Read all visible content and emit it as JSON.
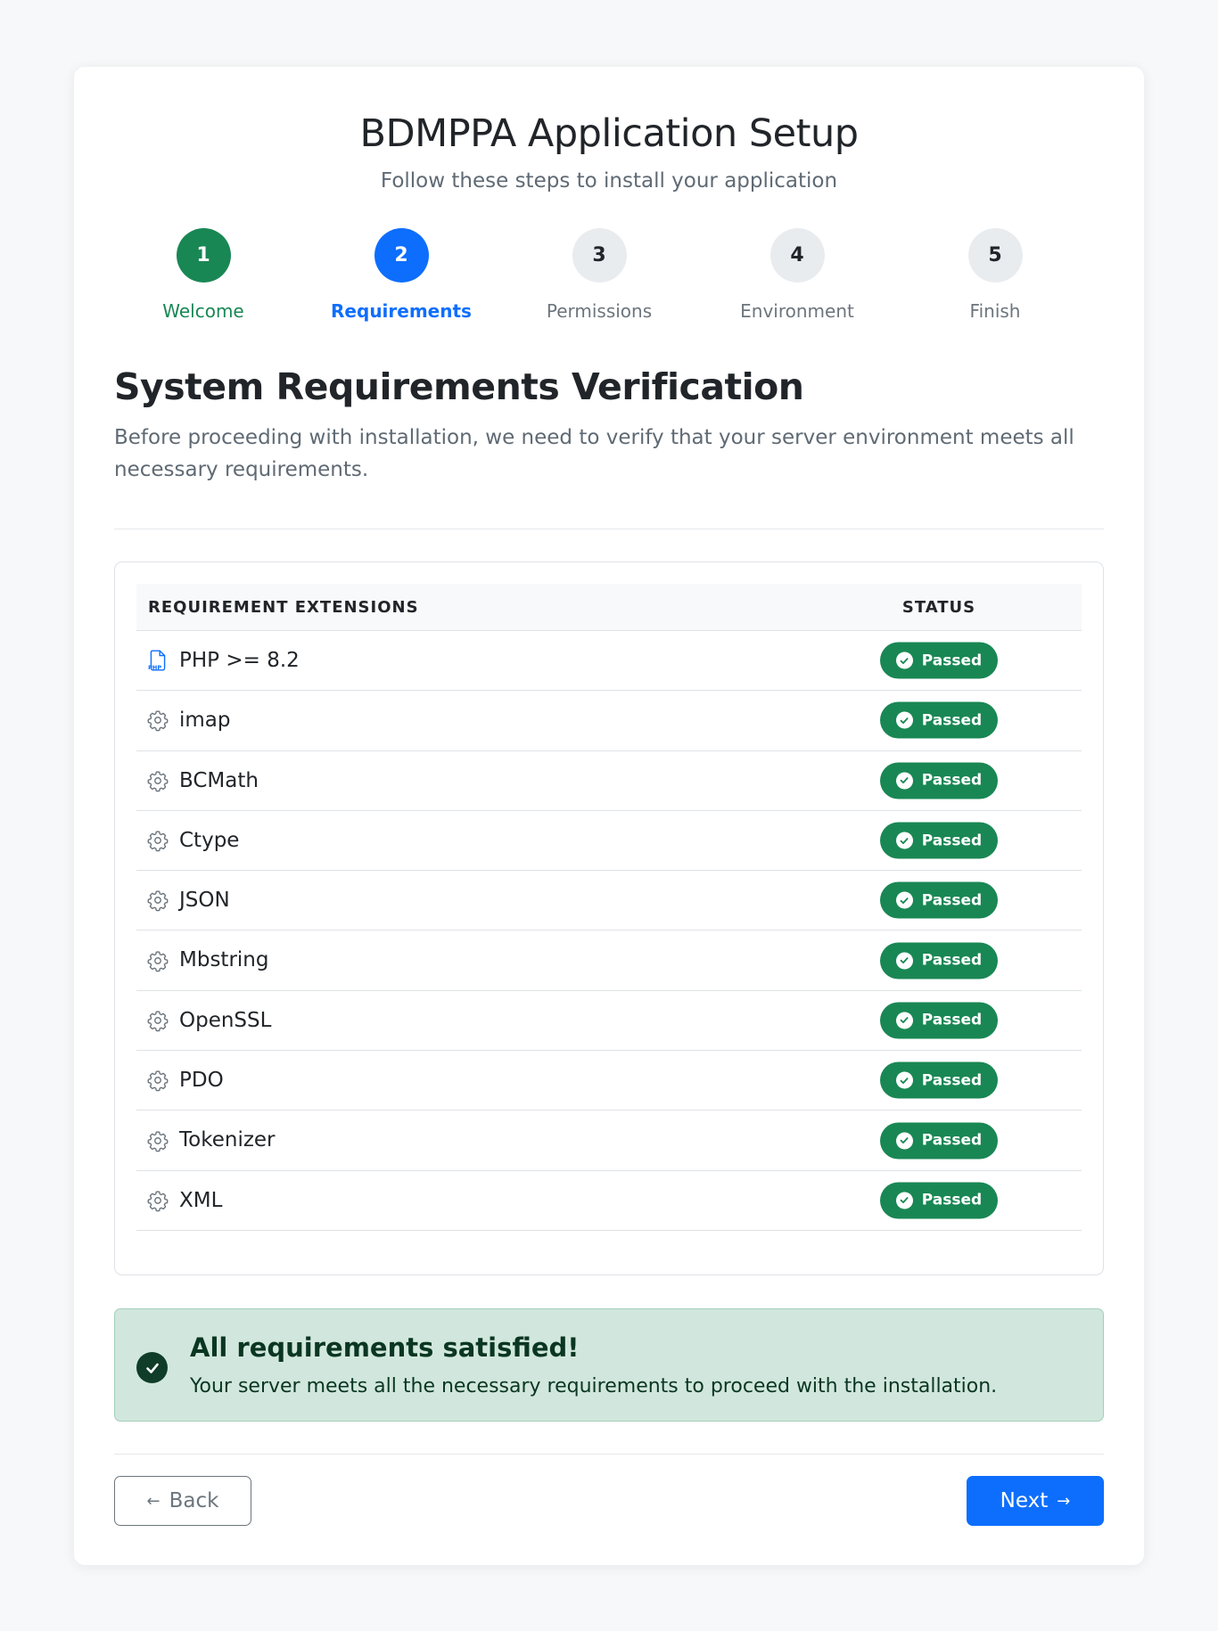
{
  "header": {
    "title": "BDMPPA Application Setup",
    "subtitle": "Follow these steps to install your application"
  },
  "steps": [
    {
      "number": "1",
      "label": "Welcome",
      "state": "completed"
    },
    {
      "number": "2",
      "label": "Requirements",
      "state": "active"
    },
    {
      "number": "3",
      "label": "Permissions",
      "state": "pending"
    },
    {
      "number": "4",
      "label": "Environment",
      "state": "pending"
    },
    {
      "number": "5",
      "label": "Finish",
      "state": "pending"
    }
  ],
  "section": {
    "title": "System Requirements Verification",
    "description": "Before proceeding with installation, we need to verify that your server environment meets all necessary requirements."
  },
  "table": {
    "headers": {
      "requirement": "REQUIREMENT EXTENSIONS",
      "status": "STATUS"
    },
    "rows": [
      {
        "name": "PHP >= 8.2",
        "icon": "php-file-icon",
        "status": "Passed"
      },
      {
        "name": "imap",
        "icon": "gear-icon",
        "status": "Passed"
      },
      {
        "name": "BCMath",
        "icon": "gear-icon",
        "status": "Passed"
      },
      {
        "name": "Ctype",
        "icon": "gear-icon",
        "status": "Passed"
      },
      {
        "name": "JSON",
        "icon": "gear-icon",
        "status": "Passed"
      },
      {
        "name": "Mbstring",
        "icon": "gear-icon",
        "status": "Passed"
      },
      {
        "name": "OpenSSL",
        "icon": "gear-icon",
        "status": "Passed"
      },
      {
        "name": "PDO",
        "icon": "gear-icon",
        "status": "Passed"
      },
      {
        "name": "Tokenizer",
        "icon": "gear-icon",
        "status": "Passed"
      },
      {
        "name": "XML",
        "icon": "gear-icon",
        "status": "Passed"
      }
    ]
  },
  "alert": {
    "title": "All requirements satisfied!",
    "message": "Your server meets all the necessary requirements to proceed with the installation."
  },
  "buttons": {
    "back": "Back",
    "next": "Next"
  },
  "colors": {
    "success": "#198754",
    "primary": "#0d6efd",
    "muted": "#6c757d",
    "alert_bg": "#d1e7dd"
  }
}
